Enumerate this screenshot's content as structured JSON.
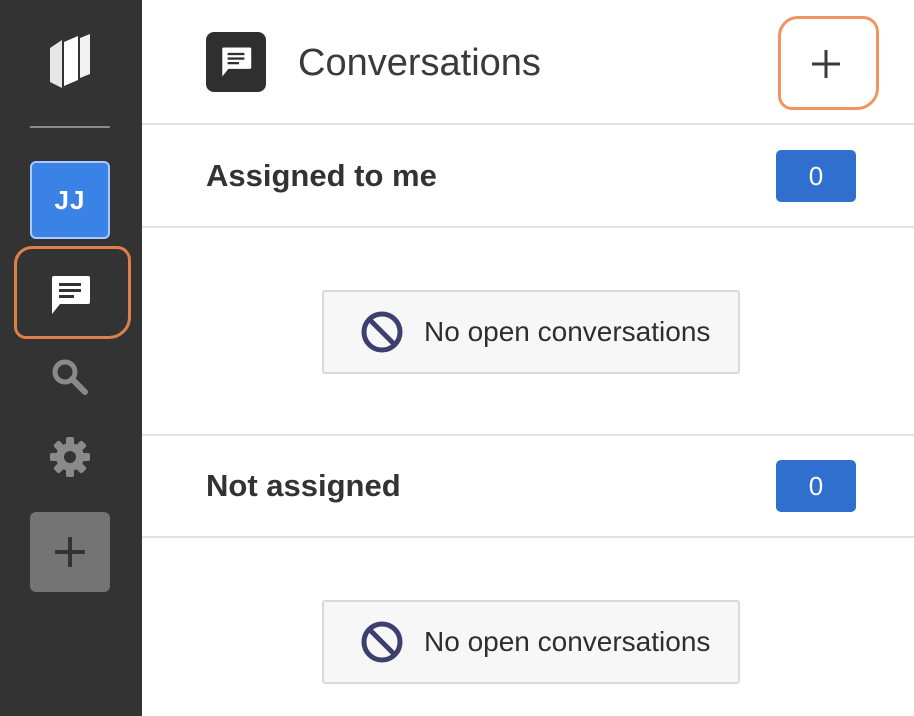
{
  "sidebar": {
    "logo_icon": "stacked-pages-logo",
    "avatar_initials": "JJ",
    "items": [
      {
        "icon": "chat-icon",
        "active": true
      },
      {
        "icon": "search-icon"
      },
      {
        "icon": "gear-icon"
      },
      {
        "icon": "plus-icon"
      }
    ]
  },
  "header": {
    "title": "Conversations",
    "icon": "chat-icon",
    "new_button_icon": "plus-icon"
  },
  "sections": [
    {
      "title": "Assigned to me",
      "count": "0",
      "empty_text": "No open conversations",
      "empty_icon": "ban-icon"
    },
    {
      "title": "Not assigned",
      "count": "0",
      "empty_text": "No open conversations",
      "empty_icon": "ban-icon"
    }
  ],
  "colors": {
    "sidebar_bg": "#333333",
    "avatar_bg": "#3b82e6",
    "badge_bg": "#2f6fcd",
    "highlight": "#f08a4e"
  }
}
